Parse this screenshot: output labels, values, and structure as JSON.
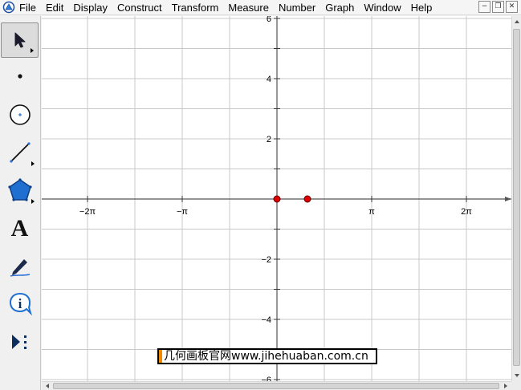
{
  "menubar": {
    "items": [
      "File",
      "Edit",
      "Display",
      "Construct",
      "Transform",
      "Measure",
      "Number",
      "Graph",
      "Window",
      "Help"
    ],
    "window_controls": [
      "−",
      "❐",
      "✕"
    ]
  },
  "toolbox": {
    "tools": [
      {
        "name": "arrow-tool-icon",
        "selected": true,
        "has_submenu": true
      },
      {
        "name": "point-tool-icon",
        "selected": false,
        "has_submenu": false
      },
      {
        "name": "compass-tool-icon",
        "selected": false,
        "has_submenu": false
      },
      {
        "name": "straightedge-tool-icon",
        "selected": false,
        "has_submenu": true
      },
      {
        "name": "polygon-tool-icon",
        "selected": false,
        "has_submenu": true
      },
      {
        "name": "text-tool-icon",
        "selected": false,
        "has_submenu": false,
        "label": "A"
      },
      {
        "name": "marker-tool-icon",
        "selected": false,
        "has_submenu": false
      },
      {
        "name": "information-tool-icon",
        "selected": false,
        "has_submenu": false,
        "label": "i"
      },
      {
        "name": "custom-tool-icon",
        "selected": false,
        "has_submenu": false
      }
    ]
  },
  "graph": {
    "x_tick_labels": [
      "−2π",
      "−π",
      "π",
      "2π"
    ],
    "y_tick_labels": [
      "6",
      "4",
      "2",
      "−2",
      "−4",
      "−6"
    ],
    "axis_color": "#555555",
    "grid_color": "#c8c8c8",
    "point_color": "#e00000",
    "points": [
      {
        "label": "origin-point",
        "x": 0,
        "y": 0
      },
      {
        "label": "unit-point",
        "x": 1,
        "y": 0
      }
    ]
  },
  "watermark": {
    "text": "几何画板官网www.jihehuaban.com.cn",
    "accent": "#f28a00"
  }
}
